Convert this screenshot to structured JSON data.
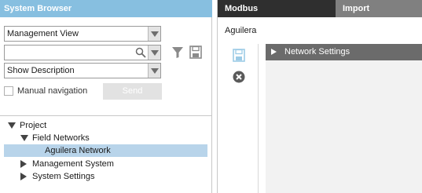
{
  "left_panel": {
    "header_title": "System Browser",
    "view_select": {
      "value": "Management View"
    },
    "search": {
      "value": "",
      "placeholder": ""
    },
    "description_select": {
      "value": "Show Description"
    },
    "manual_navigation_label": "Manual navigation",
    "manual_navigation_checked": false,
    "send_label": "Send",
    "tree": [
      {
        "label": "Project",
        "expanded": true,
        "selected": false
      },
      {
        "label": "Field Networks",
        "expanded": true,
        "selected": false
      },
      {
        "label": "Aguilera Network",
        "expanded": null,
        "selected": true
      },
      {
        "label": "Management System",
        "expanded": false,
        "selected": false
      },
      {
        "label": "System Settings",
        "expanded": false,
        "selected": false
      }
    ]
  },
  "right_panel": {
    "tabs": [
      {
        "label": "Modbus",
        "active": true
      },
      {
        "label": "Import",
        "active": false
      }
    ],
    "title": "Aguilera",
    "section": {
      "label": "Network Settings",
      "expanded": false
    }
  },
  "icons": {
    "search": "magnifier-icon",
    "filter": "filter-icon",
    "save": "floppy-disk-icon",
    "close": "close-circle-icon"
  },
  "colors": {
    "header_blue": "#87bfe0",
    "selection": "#b8d4ea",
    "active_tab": "#2f2f2f",
    "inactive_tab": "#808080",
    "section_header": "#6b6b6b"
  }
}
